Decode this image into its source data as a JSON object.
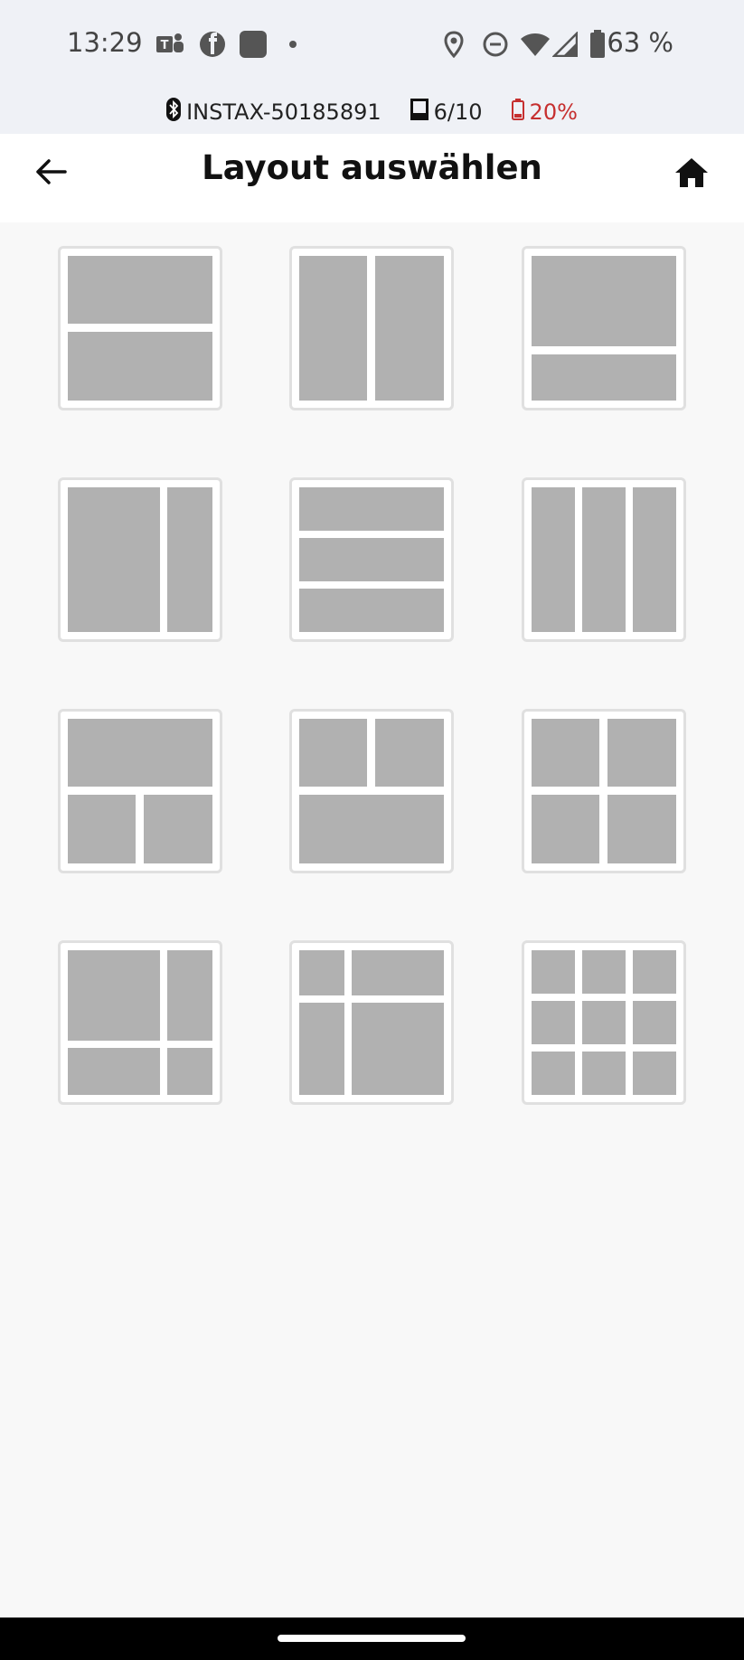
{
  "status_bar": {
    "time": "13:29",
    "battery_percent": "63 %",
    "notification_icons": [
      "teams-icon",
      "facebook-icon",
      "app-icon",
      "dot-icon"
    ],
    "system_icons": [
      "location-icon",
      "do-not-disturb-icon",
      "wifi-icon",
      "signal-icon",
      "battery-icon"
    ]
  },
  "printer_bar": {
    "device_name": "INSTAX-50185891",
    "film_count": "6/10",
    "printer_battery": "20%",
    "printer_battery_color": "#c62f2f"
  },
  "header": {
    "title": "Layout auswählen",
    "back_icon": "arrow-left-icon",
    "home_icon": "home-icon"
  },
  "layouts": [
    {
      "id": "layout-2-horizontal"
    },
    {
      "id": "layout-2-vertical"
    },
    {
      "id": "layout-large-top-small-bottom"
    },
    {
      "id": "layout-large-left-narrow-right"
    },
    {
      "id": "layout-3-horizontal"
    },
    {
      "id": "layout-3-vertical"
    },
    {
      "id": "layout-1-top-2-bottom"
    },
    {
      "id": "layout-2-top-1-bottom"
    },
    {
      "id": "layout-2x2-grid"
    },
    {
      "id": "layout-4-asymmetric-a"
    },
    {
      "id": "layout-4-asymmetric-b"
    },
    {
      "id": "layout-3x3-grid"
    }
  ],
  "colors": {
    "tile_cell": "#b1b1b1",
    "tile_border": "#e0e0e0",
    "background": "#f8f8f8"
  }
}
